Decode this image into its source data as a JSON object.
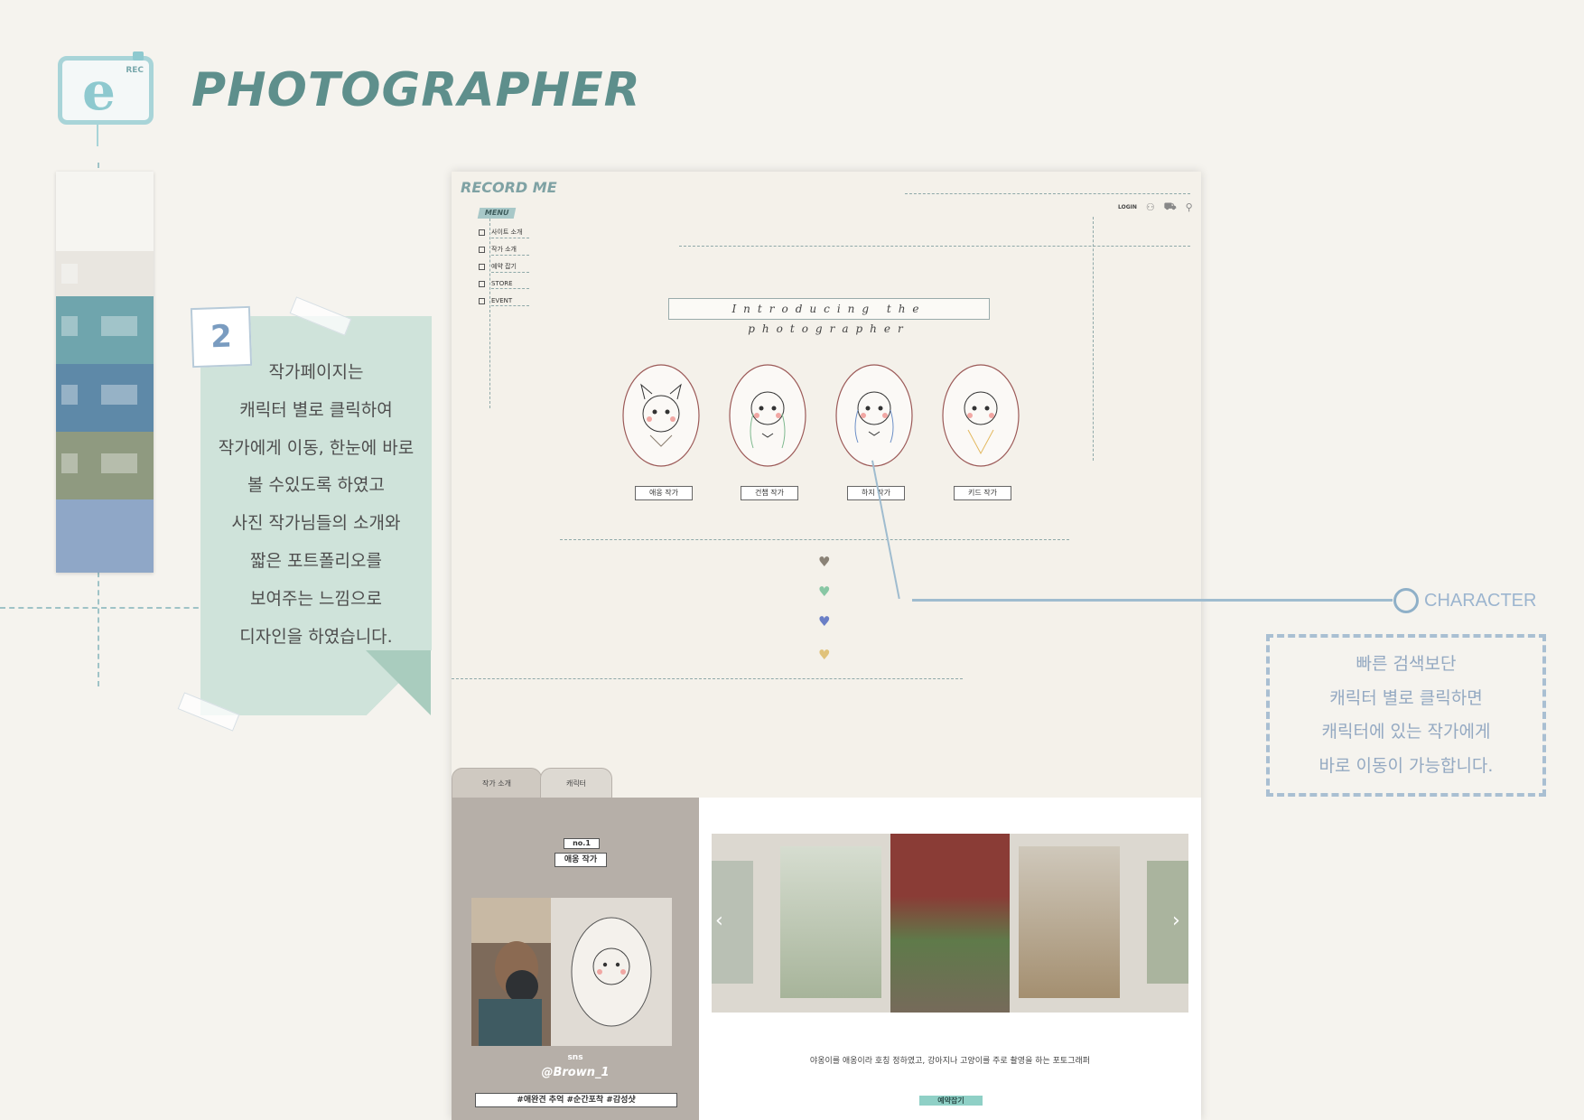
{
  "header": {
    "logo_letter": "e",
    "logo_badge": "REC",
    "title": "PHOTOGRAPHER"
  },
  "note": {
    "number": "2",
    "lines": [
      "작가페이지는",
      "캐릭터 별로 클릭하여",
      "작가에게 이동, 한눈에 바로",
      "볼 수있도록 하였고",
      "사진 작가님들의 소개와",
      "짧은 포트폴리오를",
      "보여주는 느낌으로",
      "디자인을 하였습니다."
    ]
  },
  "site": {
    "logo": "RECORD ME",
    "menu_tag": "MENU",
    "menu": [
      "사이트 소개",
      "작가 소개",
      "예약 잡기",
      "STORE",
      "EVENT"
    ],
    "login": "LOGIN",
    "banner": "Introducing the photographer",
    "characters": [
      {
        "label": "애옹 작가",
        "accent": "#8a7d6e"
      },
      {
        "label": "건챕 작가",
        "accent": "#7fb98f"
      },
      {
        "label": "하지 작가",
        "accent": "#6c8fc7"
      },
      {
        "label": "키드 작가",
        "accent": "#e3b85e"
      }
    ],
    "hearts": [
      {
        "color": "#8a8276"
      },
      {
        "color": "#88c7a4"
      },
      {
        "color": "#6a7fc6"
      },
      {
        "color": "#e0c27a"
      }
    ],
    "tabs": [
      "작가 소개",
      "캐릭터"
    ],
    "profile": {
      "no": "no.1",
      "name": "애옹 작가",
      "sns_label": "sns",
      "handle": "@Brown_1",
      "hashtags": "#애완견 추억 #순간포착 #감성샷"
    },
    "gallery": {
      "prev": "‹",
      "next": "›"
    },
    "description": "야옹이를 애옹이라 호칭 정하였고, 강아지나 고양이를 주로 촬영을 하는 포토그래퍼",
    "reserve": "예약잡기"
  },
  "callout": {
    "title": "CHARACTER",
    "lines": [
      "빠른 검색보단",
      "캐릭터 별로 클릭하면",
      "캐릭터에 있는 작가에게",
      "바로 이동이 가능합니다."
    ]
  }
}
